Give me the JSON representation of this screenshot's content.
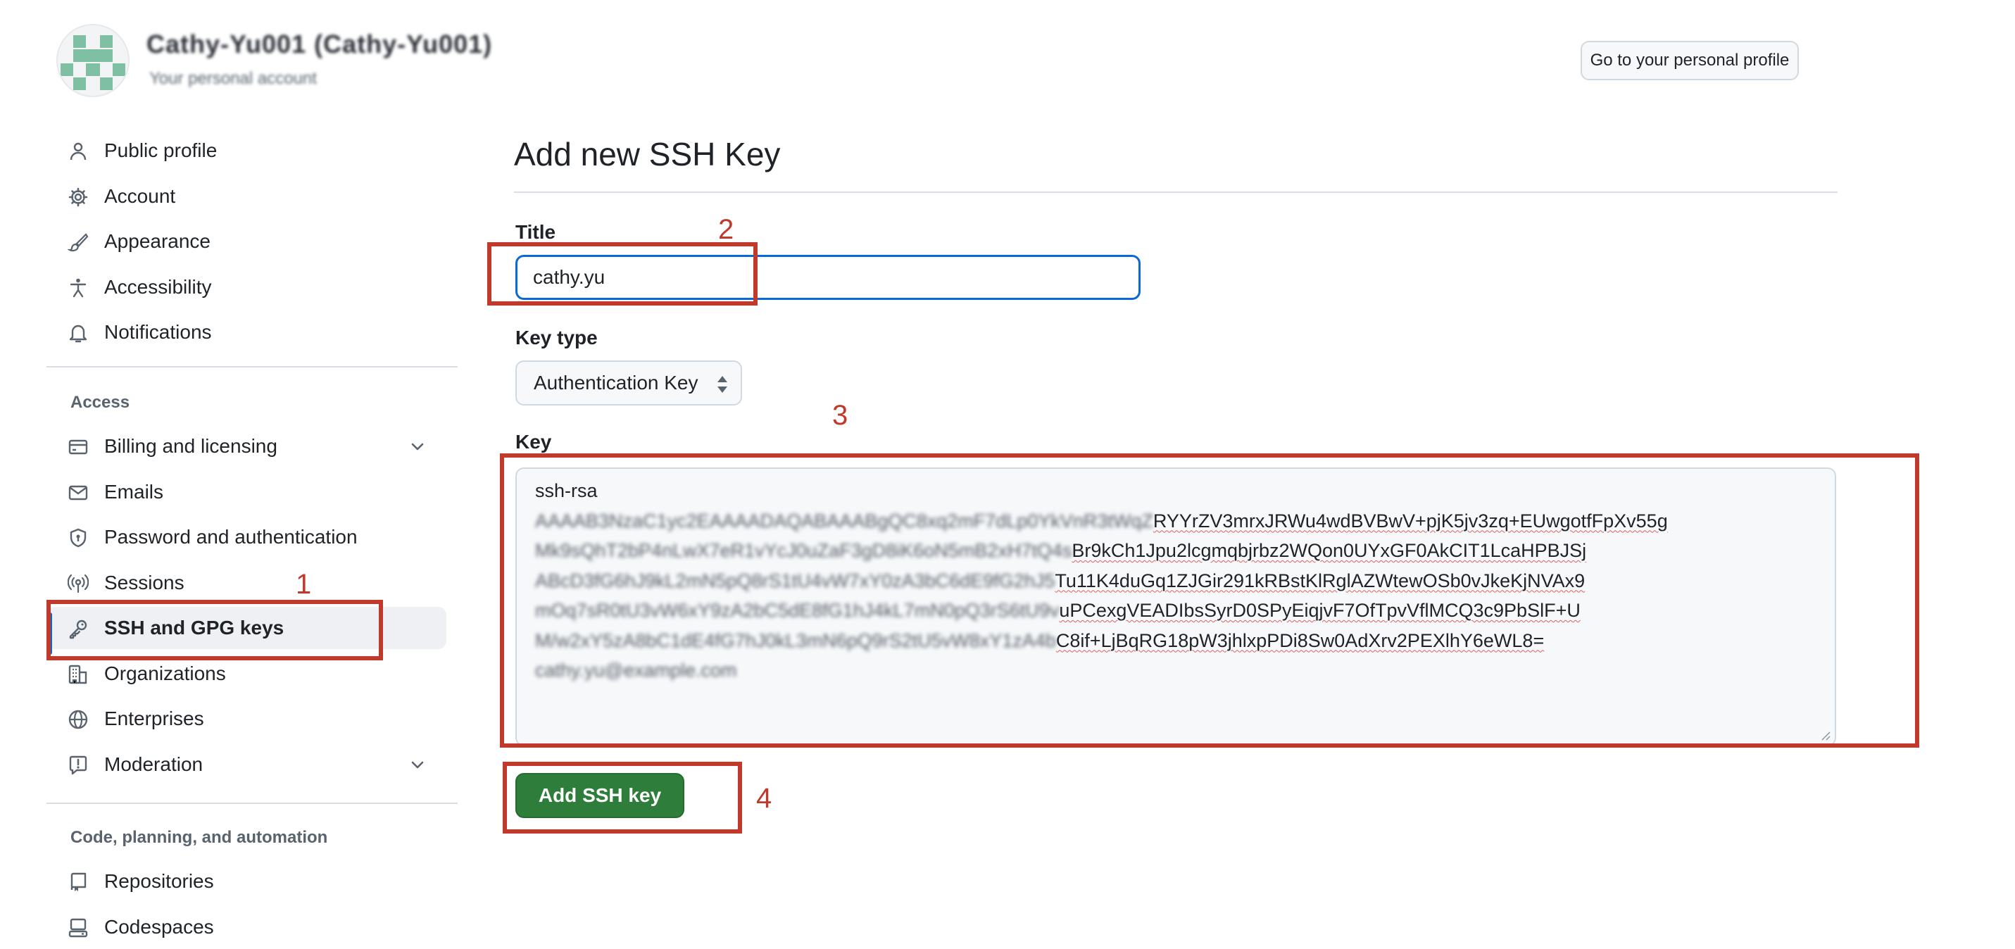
{
  "header": {
    "username": "Cathy-Yu001 (Cathy-Yu001)",
    "subtitle": "Your personal account",
    "profile_button": "Go to your personal profile"
  },
  "sidebar": {
    "items_top": [
      {
        "label": "Public profile",
        "icon": "person-icon"
      },
      {
        "label": "Account",
        "icon": "gear-icon"
      },
      {
        "label": "Appearance",
        "icon": "paintbrush-icon"
      },
      {
        "label": "Accessibility",
        "icon": "accessibility-icon"
      },
      {
        "label": "Notifications",
        "icon": "bell-icon"
      }
    ],
    "access_title": "Access",
    "items_access": [
      {
        "label": "Billing and licensing",
        "icon": "credit-card-icon",
        "expandable": true
      },
      {
        "label": "Emails",
        "icon": "mail-icon"
      },
      {
        "label": "Password and authentication",
        "icon": "shield-lock-icon"
      },
      {
        "label": "Sessions",
        "icon": "broadcast-icon"
      },
      {
        "label": "SSH and GPG keys",
        "icon": "key-icon",
        "active": true
      },
      {
        "label": "Organizations",
        "icon": "organization-icon"
      },
      {
        "label": "Enterprises",
        "icon": "globe-icon"
      },
      {
        "label": "Moderation",
        "icon": "report-icon",
        "expandable": true
      }
    ],
    "code_title": "Code, planning, and automation",
    "items_code": [
      {
        "label": "Repositories",
        "icon": "repo-icon"
      },
      {
        "label": "Codespaces",
        "icon": "codespaces-icon"
      }
    ]
  },
  "main": {
    "title": "Add new SSH Key",
    "title_label": "Title",
    "title_value": "cathy.yu",
    "keytype_label": "Key type",
    "keytype_value": "Authentication Key",
    "key_label": "Key",
    "key_lines": [
      {
        "visible": "ssh-rsa",
        "blurred": ""
      },
      {
        "blurred": "AAAAB3NzaC1yc2EAAAADAQABAAABgQC8xq2mF7dLp0YkVnR3tWqZ",
        "visible": "RYYrZV3mrxJRWu4wdBVBwV+pjK5jv3zq+EUwgotfFpXv55g"
      },
      {
        "blurred": "Mk9sQhT2bP4nLwX7eR1vYcJ0uZaF3gD8iK6oN5mB2xH7tQ4s",
        "visible": "Br9kCh1Jpu2lcgmqbjrbz2WQon0UYxGF0AkCIT1LcaHPBJSj"
      },
      {
        "blurred": "ABcD3fG6hJ9kL2mN5pQ8rS1tU4vW7xY0zA3bC6dE9fG2hJ5",
        "visible": "Tu11K4duGq1ZJGir291kRBstKlRglAZWtewOSb0vJkeKjNVAx9"
      },
      {
        "blurred": "mOq7sR0tU3vW6xY9zA2bC5dE8fG1hJ4kL7mN0pQ3rS6tU9v",
        "visible": "uPCexgVEADIbsSyrD0SPyEiqjvF7OfTpvVflMCQ3c9PbSlF+U"
      },
      {
        "blurred": "M/w2xY5zA8bC1dE4fG7hJ0kL3mN6pQ9rS2tU5vW8xY1zA4b",
        "visible": "C8if+LjBqRG18pW3jhlxpPDi8Sw0AdXrv2PEXlhY6eWL8="
      },
      {
        "blurred": "cathy.yu@example.com",
        "visible": ""
      }
    ],
    "submit_label": "Add SSH key"
  },
  "annotations": {
    "n1": "1",
    "n2": "2",
    "n3": "3",
    "n4": "4",
    "color": "#c0392b"
  },
  "colors": {
    "accent": "#0969da",
    "success": "#2f7d3b",
    "annotation": "#c0392b"
  }
}
